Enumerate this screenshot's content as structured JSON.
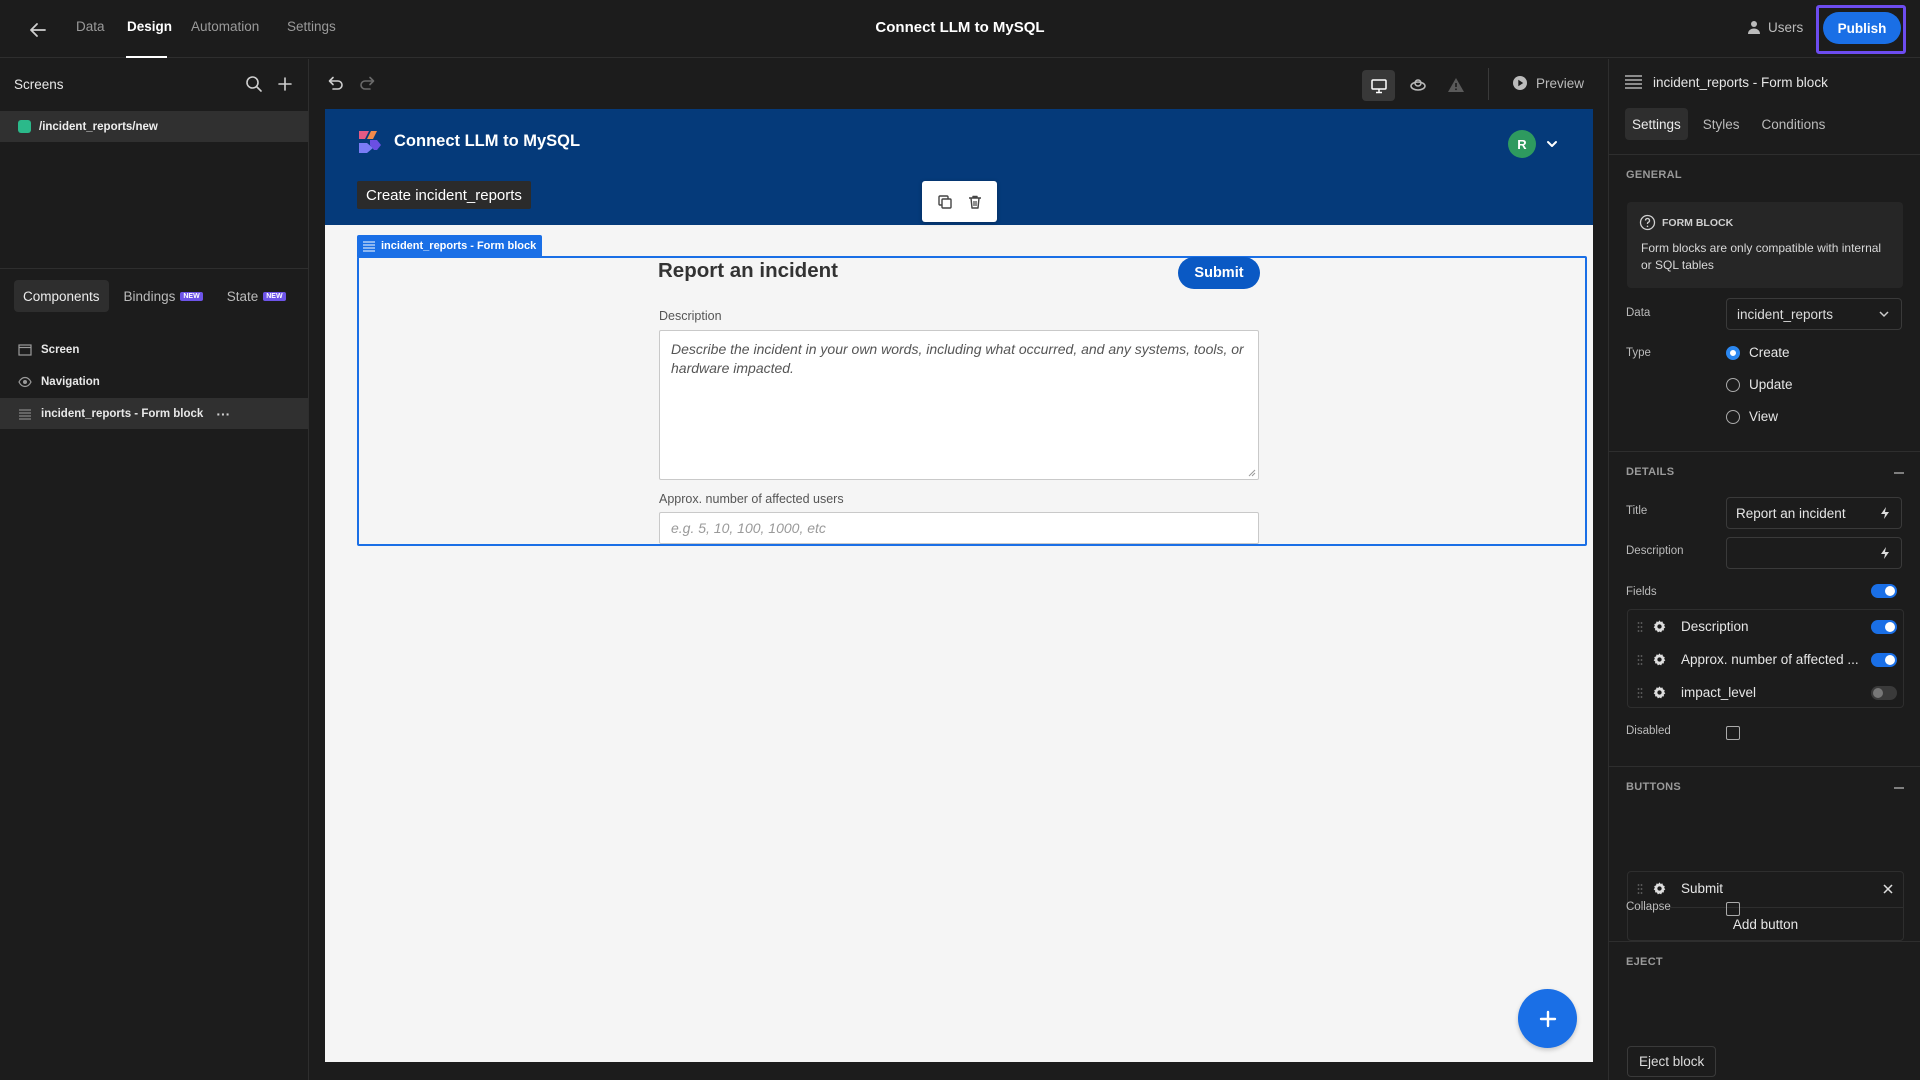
{
  "topbar": {
    "nav": [
      {
        "label": "Data",
        "active": false
      },
      {
        "label": "Design",
        "active": true
      },
      {
        "label": "Automation",
        "active": false
      },
      {
        "label": "Settings",
        "active": false
      }
    ],
    "app_title": "Connect LLM to MySQL",
    "users_label": "Users",
    "publish_label": "Publish"
  },
  "left": {
    "screens_label": "Screens",
    "screen_route": "/incident_reports/new",
    "tabs": {
      "components": "Components",
      "bindings": "Bindings",
      "state": "State",
      "new_badge": "NEW"
    },
    "tree": {
      "screen": "Screen",
      "navigation": "Navigation",
      "form_block": "incident_reports - Form block",
      "more": "···"
    }
  },
  "toolbar": {
    "preview_label": "Preview"
  },
  "canvas": {
    "app_name": "Connect LLM to MySQL",
    "avatar_initial": "R",
    "nav_link": "Create incident_reports",
    "block_label": "incident_reports - Form block",
    "form": {
      "title": "Report an incident",
      "submit_label": "Submit",
      "description_label": "Description",
      "description_placeholder": "Describe the incident in your own words, including what occurred, and any systems, tools, or hardware impacted.",
      "users_label": "Approx. number of affected users",
      "users_placeholder": "e.g. 5, 10, 100, 1000, etc"
    }
  },
  "right": {
    "header_title": "incident_reports - Form block",
    "tabs": [
      "Settings",
      "Styles",
      "Conditions"
    ],
    "general": {
      "title": "GENERAL",
      "info_title": "FORM BLOCK",
      "info_text": "Form blocks are only compatible with internal or SQL tables",
      "data_label": "Data",
      "data_value": "incident_reports",
      "type_label": "Type",
      "type_options": [
        "Create",
        "Update",
        "View"
      ],
      "type_selected": "Create"
    },
    "details": {
      "title": "DETAILS",
      "title_label": "Title",
      "title_value": "Report an incident",
      "description_label": "Description",
      "description_value": "",
      "fields_label": "Fields",
      "fields_enabled": true,
      "fields": [
        {
          "name": "Description",
          "enabled": true
        },
        {
          "name": "Approx. number of affected ...",
          "enabled": true
        },
        {
          "name": "impact_level",
          "enabled": false
        }
      ],
      "disabled_label": "Disabled",
      "disabled_checked": false
    },
    "buttons": {
      "title": "BUTTONS",
      "items": [
        {
          "name": "Submit"
        }
      ],
      "add_label": "Add button",
      "collapse_label": "Collapse",
      "collapse_checked": false
    },
    "eject": {
      "title": "EJECT",
      "button_label": "Eject block"
    }
  },
  "colors": {
    "accent": "#1a6fe6",
    "publish_outline": "#6d4cf0",
    "app_header": "#053a7a",
    "screen_dot": "#2bb98a",
    "avatar": "#2e9a5f"
  }
}
